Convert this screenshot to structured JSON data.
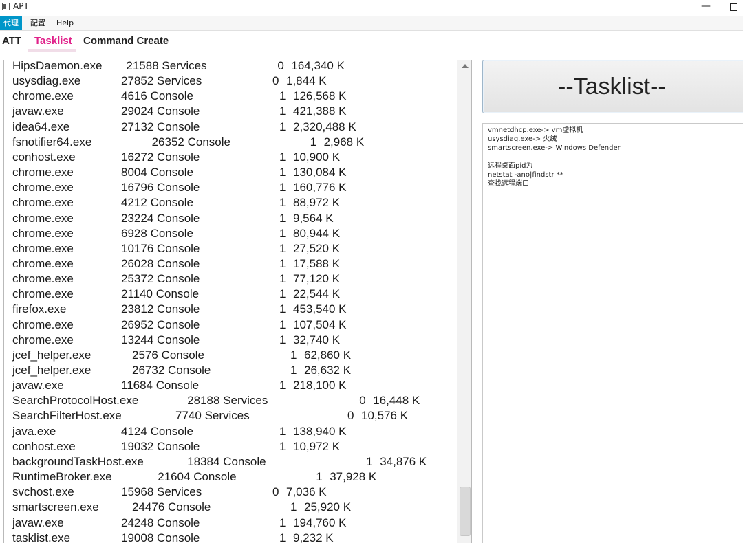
{
  "window": {
    "title": "APT",
    "minimize_glyph": "—"
  },
  "menu": [
    {
      "label": "代理",
      "active": true
    },
    {
      "label": "配置",
      "active": false
    },
    {
      "label": "Help",
      "active": false
    }
  ],
  "tabs": [
    {
      "label": "ATT",
      "selected": false
    },
    {
      "label": "Tasklist",
      "selected": true
    },
    {
      "label": "Command Create",
      "selected": false
    }
  ],
  "tasklist": [
    {
      "name": "HipsDaemon.exe",
      "pid": "21588",
      "session": "Services",
      "num": "0",
      "mem": "164,340 K"
    },
    {
      "name": "usysdiag.exe",
      "pid": "27852",
      "session": "Services",
      "num": "0",
      "mem": "1,844 K"
    },
    {
      "name": "chrome.exe",
      "pid": "4616",
      "session": "Console",
      "num": "1",
      "mem": "126,568 K"
    },
    {
      "name": "javaw.exe",
      "pid": "29024",
      "session": "Console",
      "num": "1",
      "mem": "421,388 K"
    },
    {
      "name": "idea64.exe",
      "pid": "27132",
      "session": "Console",
      "num": "1",
      "mem": "2,320,488 K"
    },
    {
      "name": "fsnotifier64.exe",
      "pid": "26352",
      "session": "Console",
      "num": "1",
      "mem": "2,968 K"
    },
    {
      "name": "conhost.exe",
      "pid": "16272",
      "session": "Console",
      "num": "1",
      "mem": "10,900 K"
    },
    {
      "name": "chrome.exe",
      "pid": "8004",
      "session": "Console",
      "num": "1",
      "mem": "130,084 K"
    },
    {
      "name": "chrome.exe",
      "pid": "16796",
      "session": "Console",
      "num": "1",
      "mem": "160,776 K"
    },
    {
      "name": "chrome.exe",
      "pid": "4212",
      "session": "Console",
      "num": "1",
      "mem": "88,972 K"
    },
    {
      "name": "chrome.exe",
      "pid": "23224",
      "session": "Console",
      "num": "1",
      "mem": "9,564 K"
    },
    {
      "name": "chrome.exe",
      "pid": "6928",
      "session": "Console",
      "num": "1",
      "mem": "80,944 K"
    },
    {
      "name": "chrome.exe",
      "pid": "10176",
      "session": "Console",
      "num": "1",
      "mem": "27,520 K"
    },
    {
      "name": "chrome.exe",
      "pid": "26028",
      "session": "Console",
      "num": "1",
      "mem": "17,588 K"
    },
    {
      "name": "chrome.exe",
      "pid": "25372",
      "session": "Console",
      "num": "1",
      "mem": "77,120 K"
    },
    {
      "name": "chrome.exe",
      "pid": "21140",
      "session": "Console",
      "num": "1",
      "mem": "22,544 K"
    },
    {
      "name": "firefox.exe",
      "pid": "23812",
      "session": "Console",
      "num": "1",
      "mem": "453,540 K"
    },
    {
      "name": "chrome.exe",
      "pid": "26952",
      "session": "Console",
      "num": "1",
      "mem": "107,504 K"
    },
    {
      "name": "chrome.exe",
      "pid": "13244",
      "session": "Console",
      "num": "1",
      "mem": "32,740 K"
    },
    {
      "name": "jcef_helper.exe",
      "pid": "2576",
      "session": "Console",
      "num": "1",
      "mem": "62,860 K"
    },
    {
      "name": "jcef_helper.exe",
      "pid": "26732",
      "session": "Console",
      "num": "1",
      "mem": "26,632 K"
    },
    {
      "name": "javaw.exe",
      "pid": "11684",
      "session": "Console",
      "num": "1",
      "mem": "218,100 K"
    },
    {
      "name": "SearchProtocolHost.exe",
      "pid": "28188",
      "session": "Services",
      "num": "0",
      "mem": "16,448 K"
    },
    {
      "name": "SearchFilterHost.exe",
      "pid": "7740",
      "session": "Services",
      "num": "0",
      "mem": "10,576 K"
    },
    {
      "name": "java.exe",
      "pid": "4124",
      "session": "Console",
      "num": "1",
      "mem": "138,940 K"
    },
    {
      "name": "conhost.exe",
      "pid": "19032",
      "session": "Console",
      "num": "1",
      "mem": "10,972 K"
    },
    {
      "name": "backgroundTaskHost.exe",
      "pid": "18384",
      "session": "Console",
      "num": "1",
      "mem": "34,876 K"
    },
    {
      "name": "RuntimeBroker.exe",
      "pid": "21604",
      "session": "Console",
      "num": "1",
      "mem": "37,928 K"
    },
    {
      "name": "svchost.exe",
      "pid": "15968",
      "session": "Services",
      "num": "0",
      "mem": "7,036 K"
    },
    {
      "name": "smartscreen.exe",
      "pid": "24476",
      "session": "Console",
      "num": "1",
      "mem": "25,920 K"
    },
    {
      "name": "javaw.exe",
      "pid": "24248",
      "session": "Console",
      "num": "1",
      "mem": "194,760 K"
    },
    {
      "name": "tasklist.exe",
      "pid": "19008",
      "session": "Console",
      "num": "1",
      "mem": "9,232 K"
    }
  ],
  "action_button": {
    "label": "--Tasklist--"
  },
  "notes": [
    "vmnetdhcp.exe-> vm虚拟机",
    "usysdiag.exe-> 火绒",
    "smartscreen.exe-> Windows Defender",
    "",
    "远程桌面pid为",
    "netstat -ano|findstr **",
    "查找远程端口"
  ]
}
